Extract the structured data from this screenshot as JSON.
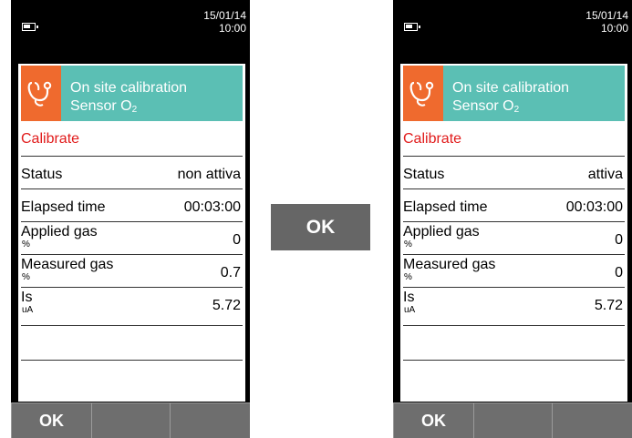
{
  "status_bar": {
    "date": "15/01/14",
    "time": "10:00"
  },
  "header": {
    "title_line1": "On site calibration",
    "title_line2_prefix": "Sensor O",
    "title_line2_sub": "2"
  },
  "section_title": "Calibrate",
  "screens": [
    {
      "rows": [
        {
          "label": "Status",
          "unit": "",
          "value": "non attiva"
        },
        {
          "label": "Elapsed time",
          "unit": "",
          "value": "00:03:00"
        },
        {
          "label": "Applied gas",
          "unit": "%",
          "value": "0"
        },
        {
          "label": "Measured gas",
          "unit": "%",
          "value": "0.7"
        },
        {
          "label": "Is",
          "unit": "uA",
          "value": "5.72"
        }
      ],
      "softkeys": [
        "OK",
        "",
        ""
      ]
    },
    {
      "rows": [
        {
          "label": "Status",
          "unit": "",
          "value": "attiva"
        },
        {
          "label": "Elapsed time",
          "unit": "",
          "value": "00:03:00"
        },
        {
          "label": "Applied gas",
          "unit": "%",
          "value": "0"
        },
        {
          "label": "Measured gas",
          "unit": "%",
          "value": "0"
        },
        {
          "label": "Is",
          "unit": "uA",
          "value": "5.72"
        }
      ],
      "softkeys": [
        "OK",
        "",
        ""
      ]
    }
  ],
  "transition_button": "OK",
  "colors": {
    "header": "#5bbfb4",
    "icon_bg": "#ef6a2e",
    "section_title": "#e11c1c",
    "softkey": "#6e6e6e"
  },
  "icons": {
    "header_icon": "stethoscope-icon",
    "battery": "battery-icon"
  }
}
